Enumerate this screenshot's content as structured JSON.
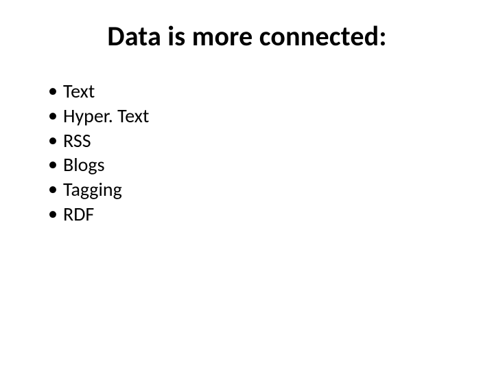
{
  "slide": {
    "title": "Data is more connected:",
    "bullets": [
      "Text",
      "Hyper. Text",
      "RSS",
      "Blogs",
      "Tagging",
      "RDF"
    ]
  }
}
